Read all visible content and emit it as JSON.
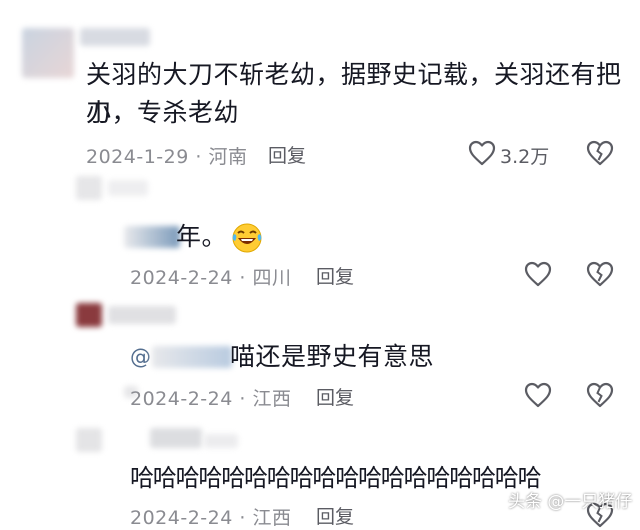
{
  "comments": [
    {
      "text_line1": "关羽的大刀不斩老幼，据野史记载，关羽还有把小",
      "text_line2": "刀，专杀老幼",
      "date": "2024-1-29",
      "location": "河南",
      "reply_label": "回复",
      "like_count": "3.2万"
    },
    {
      "text_suffix": "年。",
      "emoji": "😂",
      "date": "2024-2-24",
      "location": "四川",
      "reply_label": "回复"
    },
    {
      "mention_prefix": "@",
      "text_suffix": "喵还是野史有意思",
      "date": "2024-2-24",
      "location": "江西",
      "reply_label": "回复"
    },
    {
      "text": "哈哈哈哈哈哈哈哈哈哈哈哈哈哈哈哈哈哈",
      "date": "2024-2-24",
      "location": "江西",
      "reply_label": "回复"
    }
  ],
  "separator": "·",
  "watermark": "头条 @一只猪仔",
  "colors": {
    "text": "#161823",
    "meta": "#8a8b91",
    "mention": "#546e8f"
  },
  "icons": [
    "heart-outline-icon",
    "broken-heart-icon"
  ]
}
